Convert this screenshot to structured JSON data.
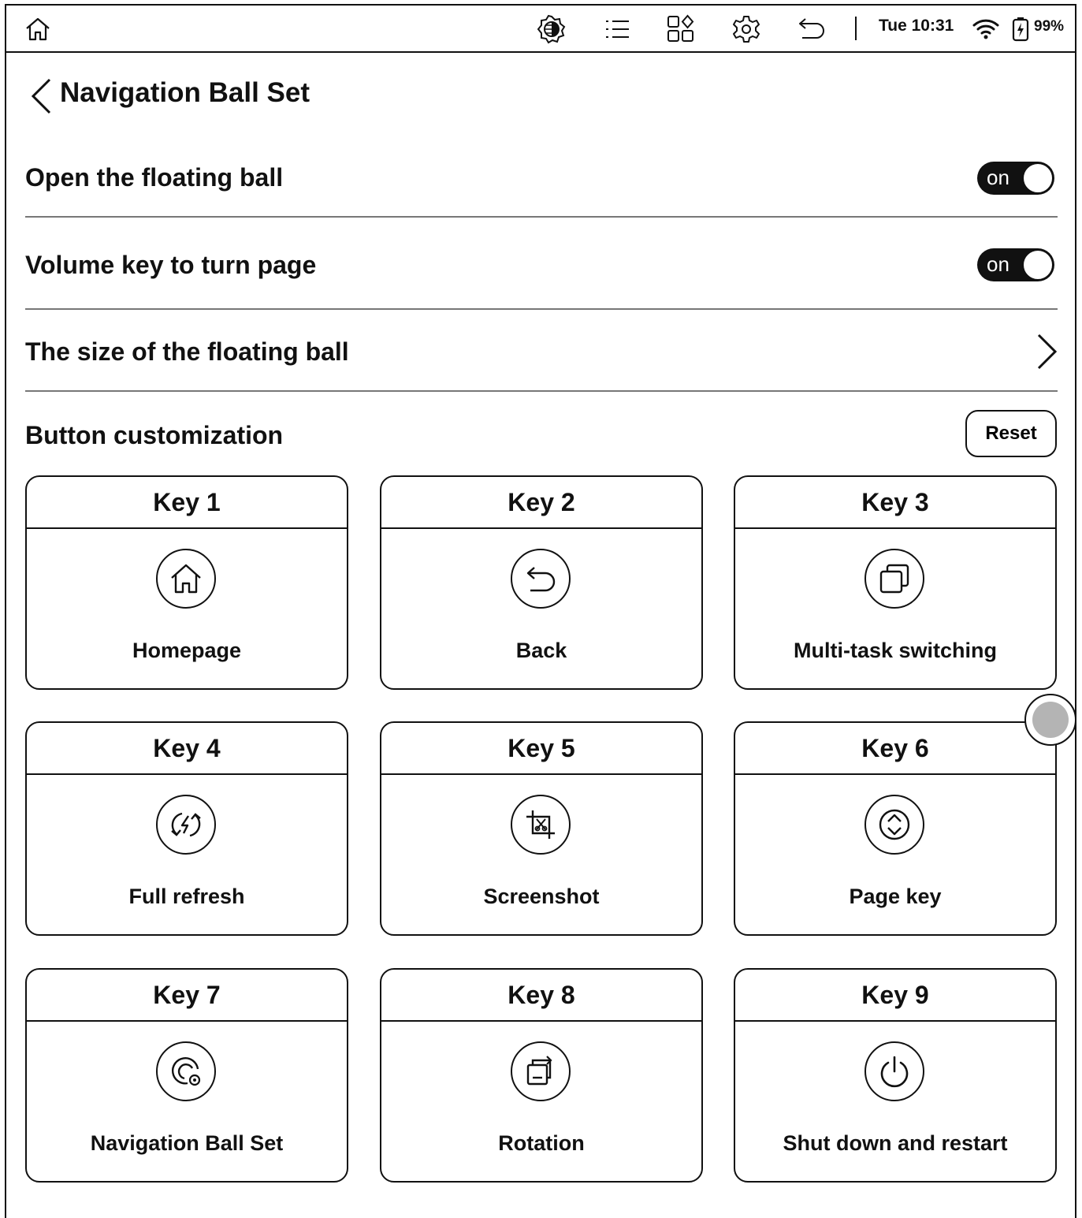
{
  "status_bar": {
    "time": "Tue 10:31",
    "battery": "99%",
    "icons": [
      "home-icon",
      "contrast-icon",
      "list-icon",
      "apps-icon",
      "settings-icon",
      "undo-icon",
      "wifi-icon",
      "battery-charging-icon"
    ]
  },
  "header": {
    "title": "Navigation Ball Set"
  },
  "settings": {
    "floating_ball": {
      "label": "Open the floating ball",
      "toggle": "on",
      "enabled": true
    },
    "volume_key": {
      "label": "Volume key to turn page",
      "toggle": "on",
      "enabled": true
    },
    "ball_size": {
      "label": "The size of the floating ball"
    }
  },
  "customization": {
    "title": "Button customization",
    "reset_label": "Reset",
    "keys": [
      {
        "title": "Key 1",
        "action": "Homepage",
        "icon": "home-icon"
      },
      {
        "title": "Key 2",
        "action": "Back",
        "icon": "back-arrow-icon"
      },
      {
        "title": "Key 3",
        "action": "Multi-task switching",
        "icon": "multitask-icon"
      },
      {
        "title": "Key 4",
        "action": "Full refresh",
        "icon": "refresh-icon"
      },
      {
        "title": "Key 5",
        "action": "Screenshot",
        "icon": "screenshot-icon"
      },
      {
        "title": "Key 6",
        "action": "Page key",
        "icon": "page-key-icon"
      },
      {
        "title": "Key 7",
        "action": "Navigation Ball Set",
        "icon": "navigation-ball-icon"
      },
      {
        "title": "Key 8",
        "action": "Rotation",
        "icon": "rotation-icon"
      },
      {
        "title": "Key 9",
        "action": "Shut down and restart",
        "icon": "power-icon"
      }
    ]
  },
  "colors": {
    "ink": "#111111",
    "background": "#ffffff",
    "floating_ball": "#b4b4b4"
  }
}
